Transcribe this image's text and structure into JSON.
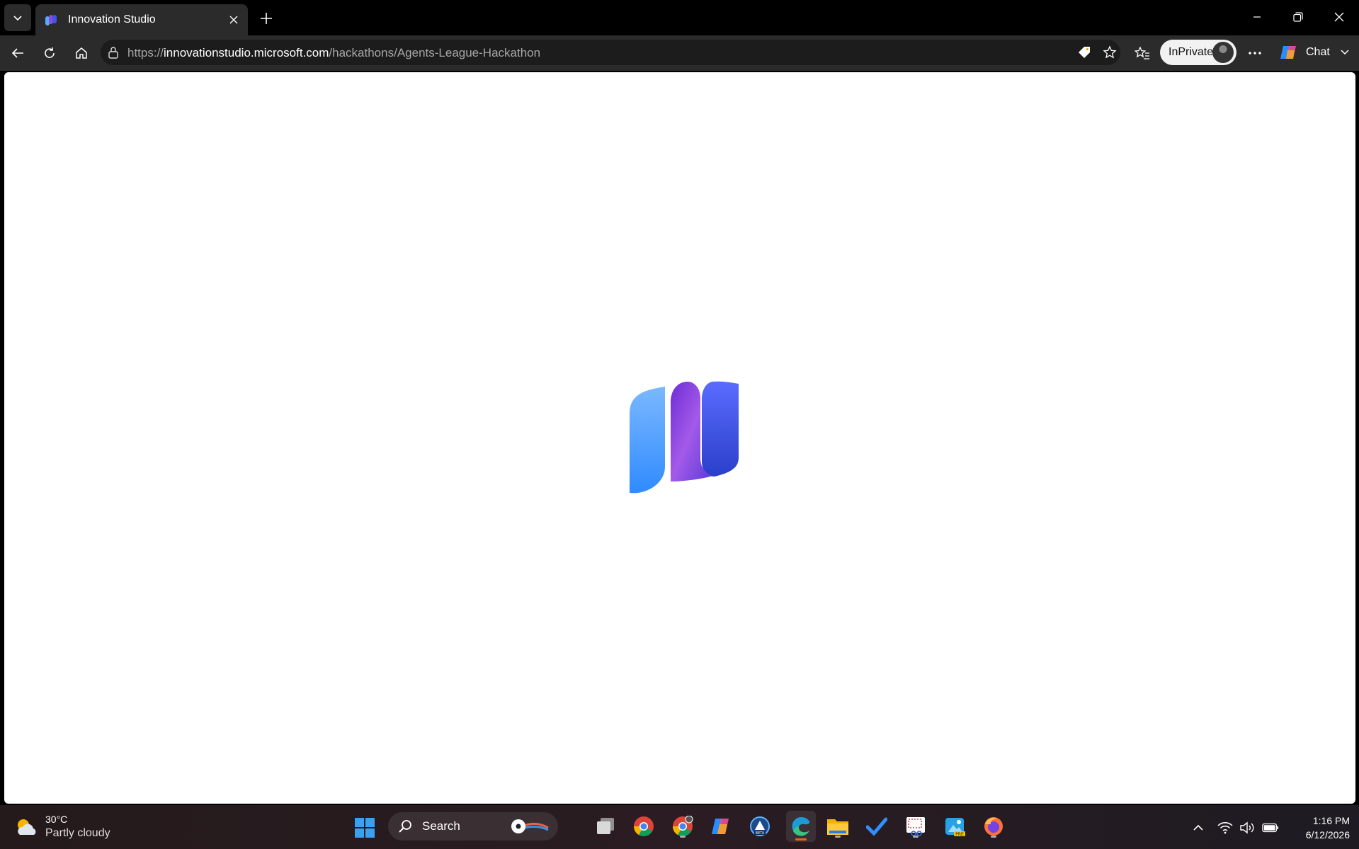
{
  "browser": {
    "tab_title": "Innovation Studio",
    "url_scheme": "https://",
    "url_host": "innovationstudio.microsoft.com",
    "url_path": "/hackathons/Agents-League-Hackathon",
    "inprivate_label": "InPrivate",
    "chat_label": "Chat"
  },
  "page": {
    "state": "loading",
    "logo_icon": "microsoft-innovation-studio-logo"
  },
  "taskbar": {
    "weather_temp": "30°C",
    "weather_condition": "Partly cloudy",
    "search_label": "Search",
    "time": "1:16 PM",
    "date": "6/12/2026",
    "apps": [
      "task-view",
      "chrome",
      "chrome-profile",
      "copilot",
      "edge-beta",
      "edge",
      "file-explorer",
      "todo",
      "snipping-tool",
      "photos-preview",
      "firefox"
    ]
  },
  "colors": {
    "accent": "#0078d4",
    "active_indicator": "#f7630c"
  }
}
